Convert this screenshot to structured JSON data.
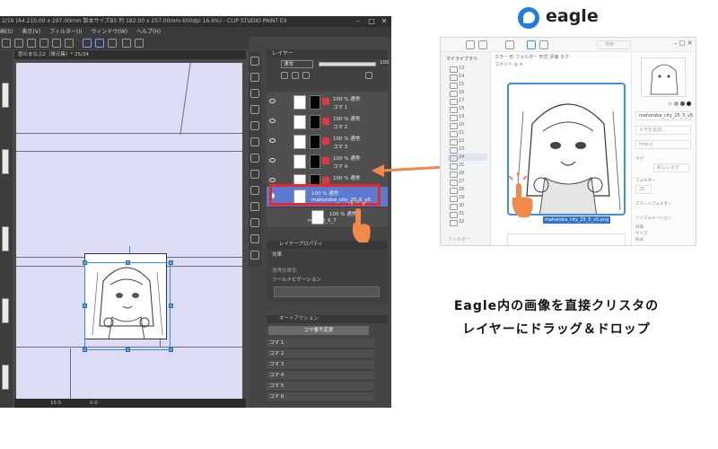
{
  "csp": {
    "title": "2/16 (A4 210.00 x 297.00mm 製本サイズB5 判 182.00 x 257.00mm 600dpi 16.6%) - CLIP STUDIO PAINT EX",
    "menu": [
      "画(S)",
      "表示(V)",
      "フィルター(I)",
      "ウィンドウ(W)",
      "ヘルプ(H)"
    ],
    "doc_tab": "窓のまなぶ2（単元集）* 25/34",
    "status_zoom": "16.5",
    "status_val": "0.0",
    "layer_panel_label": "レイヤー",
    "blend_mode": "通常",
    "opacity": "100",
    "layers": [
      {
        "mode": "100 % 通常",
        "name": "コマ 1"
      },
      {
        "mode": "100 % 通常",
        "name": "コマ 2"
      },
      {
        "mode": "100 % 通常",
        "name": "コマ 3"
      },
      {
        "mode": "100 % 通常",
        "name": "コマ 4"
      },
      {
        "mode": "100 % 通常",
        "name": "コマ 5"
      },
      {
        "mode": "100 % 通常",
        "name": "mahoroba_city_25_5_v5"
      },
      {
        "mode": "100 % 通常",
        "name": "ma158_6_7"
      }
    ],
    "props_label": "レイヤープロパティ",
    "effect_label": "効果",
    "edge_label": "境界効果色",
    "tool_nav_label": "ツールナビゲーション",
    "auto_label": "オートアクション",
    "auto_select": "コマ番号変更",
    "auto_rows": [
      "コマ 1",
      "コマ 2",
      "コマ 3",
      "コマ 4",
      "コマ 5",
      "コマ 6"
    ]
  },
  "eagle": {
    "name": "eagle",
    "library": "マイライブラリ",
    "folders": [
      "13",
      "14",
      "15",
      "16",
      "17",
      "18",
      "19",
      "20",
      "21",
      "22",
      "23",
      "24",
      "25",
      "26",
      "27",
      "28",
      "29",
      "30",
      "31",
      "32"
    ],
    "selected_folder": "24",
    "search_placeholder": "検索",
    "tags_line": "カラー  形  フォルダー  形式  評価  タグ",
    "tags_line2": "コメント  ◎  ✕",
    "selected_filename": "mahoroba_city_25_5_v5.png",
    "file_name_field": "mahoroba_city_25_5_v5",
    "notes_placeholder": "メモを追加...",
    "url_placeholder": "http://",
    "tag_label": "タグ",
    "add_tag": "新しいタグ",
    "folder_label": "フォルダー",
    "folder_value": "25",
    "smart_folder_label": "スマートフォルダー",
    "info_label": "インフォメーション",
    "info_rows": [
      "評価",
      "サイズ",
      "形式"
    ],
    "filter_label": "フィルター"
  },
  "caption": {
    "line1": "Eagle内の画像を直接クリスタの",
    "line2": "レイヤーにドラッグ＆ドロップ"
  },
  "colors": {
    "arrow": "#f08a4b",
    "highlight": "#e32b2b",
    "eagle_blue": "#1f7be6"
  }
}
